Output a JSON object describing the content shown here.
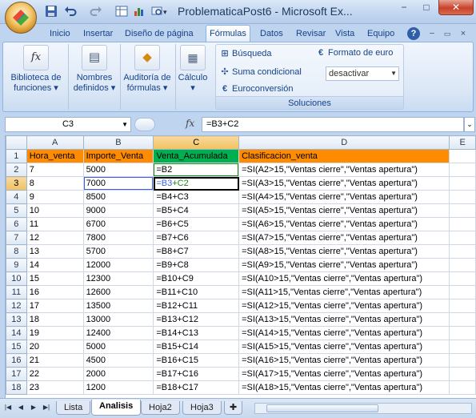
{
  "window": {
    "title": "ProblematicaPost6 - Microsoft Ex...",
    "minimize": "−",
    "maximize": "□",
    "close": "✕"
  },
  "ribbon_tabs": [
    "Inicio",
    "Insertar",
    "Diseño de página",
    "Fórmulas",
    "Datos",
    "Revisar",
    "Vista",
    "Equipo"
  ],
  "active_tab": "Fórmulas",
  "ribbon": {
    "biblioteca": "Biblioteca de funciones",
    "nombres": "Nombres definidos",
    "auditoria": "Auditoría de fórmulas",
    "calculo": "Cálculo",
    "soluciones": {
      "busqueda": "Búsqueda",
      "suma_condicional": "Suma condicional",
      "euroconversion": "Euroconversión",
      "formato_euro": "Formato de euro",
      "combo_value": "desactivar",
      "group_label": "Soluciones"
    }
  },
  "formula_bar": {
    "name_box": "C3",
    "fx": "fx",
    "formula": "=B3+C2"
  },
  "columns": [
    "A",
    "B",
    "C",
    "D",
    "E"
  ],
  "rows": [
    [
      "Hora_venta",
      "Importe_Venta",
      "Venta_Acumulada",
      "Clasificacion_venta"
    ],
    [
      "7",
      "5000",
      "=B2",
      "=SI(A2>15,\"Ventas cierre\",\"Ventas apertura\")"
    ],
    [
      "8",
      "7000",
      "=B3+C2",
      "=SI(A3>15,\"Ventas cierre\",\"Ventas apertura\")"
    ],
    [
      "9",
      "8500",
      "=B4+C3",
      "=SI(A4>15,\"Ventas cierre\",\"Ventas apertura\")"
    ],
    [
      "10",
      "9000",
      "=B5+C4",
      "=SI(A5>15,\"Ventas cierre\",\"Ventas apertura\")"
    ],
    [
      "11",
      "6700",
      "=B6+C5",
      "=SI(A6>15,\"Ventas cierre\",\"Ventas apertura\")"
    ],
    [
      "12",
      "7800",
      "=B7+C6",
      "=SI(A7>15,\"Ventas cierre\",\"Ventas apertura\")"
    ],
    [
      "13",
      "5700",
      "=B8+C7",
      "=SI(A8>15,\"Ventas cierre\",\"Ventas apertura\")"
    ],
    [
      "14",
      "12000",
      "=B9+C8",
      "=SI(A9>15,\"Ventas cierre\",\"Ventas apertura\")"
    ],
    [
      "15",
      "12300",
      "=B10+C9",
      "=SI(A10>15,\"Ventas cierre\",\"Ventas apertura\")"
    ],
    [
      "16",
      "12600",
      "=B11+C10",
      "=SI(A11>15,\"Ventas cierre\",\"Ventas apertura\")"
    ],
    [
      "17",
      "13500",
      "=B12+C11",
      "=SI(A12>15,\"Ventas cierre\",\"Ventas apertura\")"
    ],
    [
      "18",
      "13000",
      "=B13+C12",
      "=SI(A13>15,\"Ventas cierre\",\"Ventas apertura\")"
    ],
    [
      "19",
      "12400",
      "=B14+C13",
      "=SI(A14>15,\"Ventas cierre\",\"Ventas apertura\")"
    ],
    [
      "20",
      "5000",
      "=B15+C14",
      "=SI(A15>15,\"Ventas cierre\",\"Ventas apertura\")"
    ],
    [
      "21",
      "4500",
      "=B16+C15",
      "=SI(A16>15,\"Ventas cierre\",\"Ventas apertura\")"
    ],
    [
      "22",
      "2000",
      "=B17+C16",
      "=SI(A17>15,\"Ventas cierre\",\"Ventas apertura\")"
    ],
    [
      "23",
      "1200",
      "=B18+C17",
      "=SI(A18>15,\"Ventas cierre\",\"Ventas apertura\")"
    ]
  ],
  "editing_cell": {
    "part_b": "=B3",
    "part_c": "+C2"
  },
  "sheets": [
    "Lista",
    "Analisis",
    "Hoja2",
    "Hoja3"
  ],
  "active_sheet": "Analisis",
  "colors": {
    "header_orange": "#ff8c00",
    "header_green": "#00b050",
    "selection": "#f1c15f"
  }
}
